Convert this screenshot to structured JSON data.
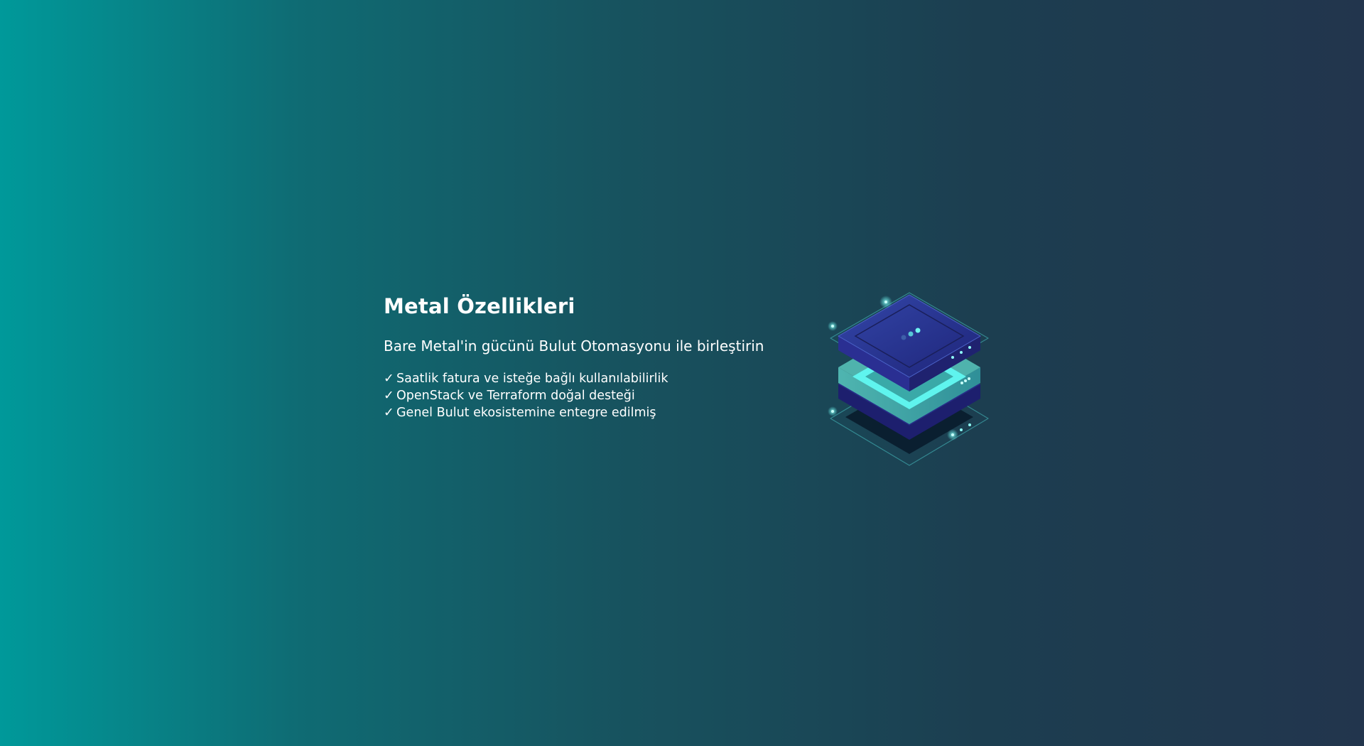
{
  "hero": {
    "title": "Metal Özellikleri",
    "subtitle": "Bare Metal'in gücünü Bulut Otomasyonu ile birleştirin",
    "check_symbol": "✓",
    "features": [
      "Saatlik fatura ve isteğe bağlı kullanılabilirlik",
      "OpenStack ve Terraform doğal desteği",
      "Genel Bulut ekosistemine entegre edilmiş"
    ]
  },
  "illustration": {
    "icon": "server-stack-icon"
  },
  "colors": {
    "gradient_start": "#00999a",
    "gradient_end": "#22354d",
    "accent_cyan": "#5ff4ee",
    "server_top": "#2b3a96",
    "server_dark": "#1d1f6e"
  }
}
